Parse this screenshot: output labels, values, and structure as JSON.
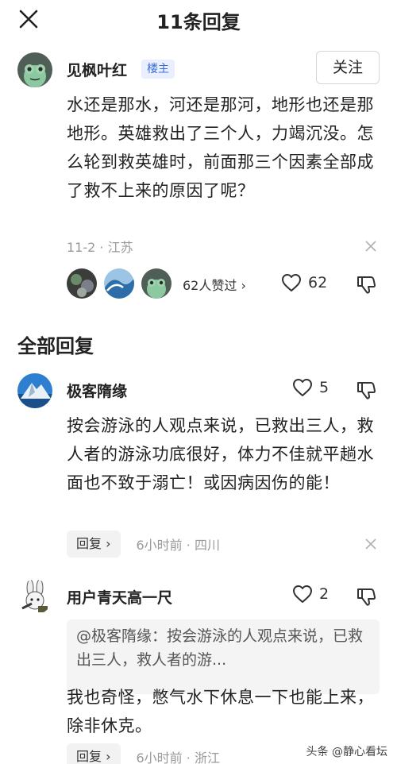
{
  "header": {
    "title": "11条回复"
  },
  "op": {
    "name": "见枫叶红",
    "badge": "楼主",
    "follow_label": "关注",
    "body": "水还是那水，河还是那河，地形也还是那地形。英雄救出了三个人，力竭沉没。怎么轮到救英雄时，前面那三个因素全部成了救不上来的原因了呢？",
    "meta": "11-2 · 江苏",
    "likers_text": "62人赞过 ›",
    "like_count": "62"
  },
  "section_title": "全部回复",
  "replies": [
    {
      "name": "极客隋缘",
      "like_count": "5",
      "body": "按会游泳的人观点来说，已救出三人，救人者的游泳功底很好，体力不佳就平趟水面也不致于溺亡！或因病因伤的能！",
      "reply_label": "回复 ›",
      "meta": "6小时前 · 四川"
    },
    {
      "name": "用户青天高一尺",
      "like_count": "2",
      "quote": "@极客隋缘：按会游泳的人观点来说，已救出三人，救人者的游...",
      "body": "我也奇怪，憋气水下休息一下也能上来，除非休克。",
      "reply_label": "回复 ›",
      "meta": "6小时前 · 浙江"
    }
  ],
  "watermark": "头条 @静心看坛",
  "icons": {
    "close": "close-icon",
    "heart": "heart-icon",
    "dislike": "thumbs-down-icon",
    "dismiss": "dismiss-x-icon"
  },
  "colors": {
    "badge_text": "#3a6bd4",
    "badge_bg": "#e9efff",
    "meta_gray": "#999999"
  }
}
